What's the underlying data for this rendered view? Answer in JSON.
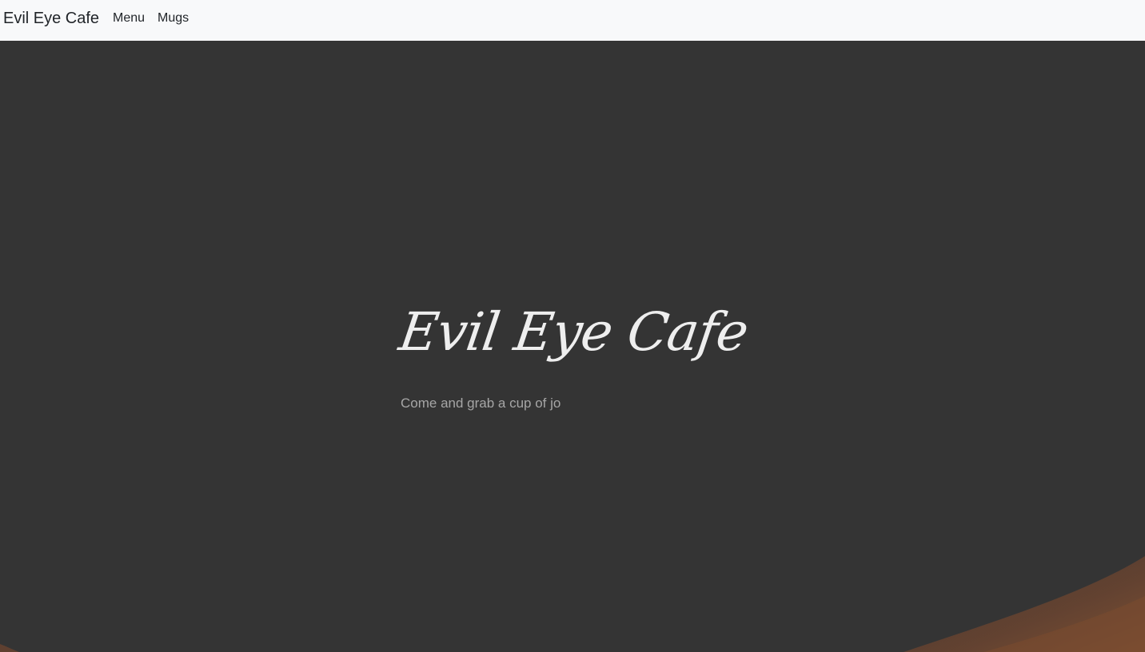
{
  "navbar": {
    "brand": "Evil Eye Cafe",
    "links": [
      {
        "label": "Menu"
      },
      {
        "label": "Mugs"
      }
    ]
  },
  "hero": {
    "title": "Evil Eye Cafe",
    "subtitle": "Come and grab a cup of jo"
  },
  "colors": {
    "navbar_bg": "#f8f9fa",
    "hero_bg": "#343434",
    "title_color": "#eeeeee",
    "subtitle_color": "#a6a6a6",
    "accent_swoosh": "#7a4b2e"
  }
}
